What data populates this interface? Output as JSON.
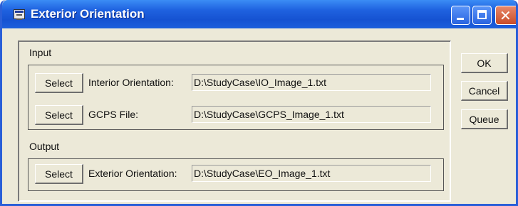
{
  "window": {
    "title": "Exterior Orientation"
  },
  "input_section": {
    "label": "Input",
    "rows": [
      {
        "button": "Select",
        "label": "Interior Orientation:",
        "value": "D:\\StudyCase\\IO_Image_1.txt"
      },
      {
        "button": "Select",
        "label": "GCPS File:",
        "value": "D:\\StudyCase\\GCPS_Image_1.txt"
      }
    ]
  },
  "output_section": {
    "label": "Output",
    "rows": [
      {
        "button": "Select",
        "label": "Exterior Orientation:",
        "value": "D:\\StudyCase\\EO_Image_1.txt"
      }
    ]
  },
  "actions": {
    "ok": "OK",
    "cancel": "Cancel",
    "queue": "Queue"
  },
  "colors": {
    "titlebar": "#1f62e0",
    "face": "#ece9d8"
  }
}
